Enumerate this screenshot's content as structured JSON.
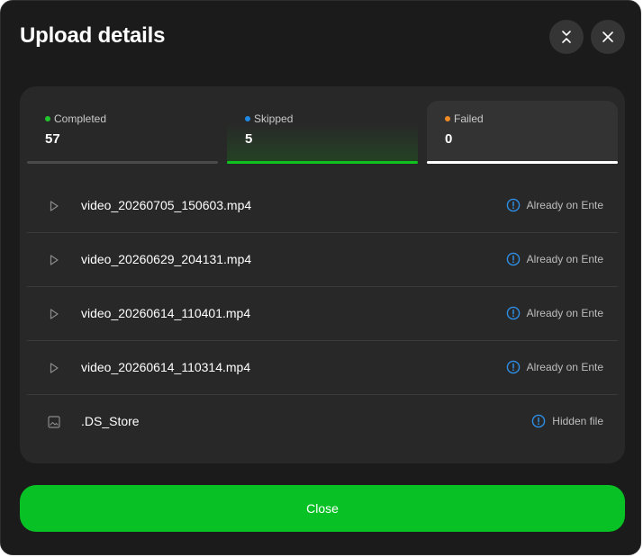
{
  "dialog": {
    "title": "Upload details",
    "collapse_icon": "collapse-chevrons-icon",
    "close_icon": "close-icon"
  },
  "tabs": [
    {
      "label": "Completed",
      "count": "57",
      "dot_color": "#22c52e",
      "bar_color": "#4a4a4a",
      "selected": false
    },
    {
      "label": "Skipped",
      "count": "5",
      "dot_color": "#1e88e5",
      "bar_color": "#10c21f",
      "selected": false
    },
    {
      "label": "Failed",
      "count": "0",
      "dot_color": "#f08a24",
      "bar_color": "#ffffff",
      "selected": true
    }
  ],
  "files": [
    {
      "name": "video_20260705_150603.mp4",
      "icon": "play-icon",
      "status": "Already on Ente",
      "status_icon": "info-icon"
    },
    {
      "name": "video_20260629_204131.mp4",
      "icon": "play-icon",
      "status": "Already on Ente",
      "status_icon": "info-icon"
    },
    {
      "name": "video_20260614_110401.mp4",
      "icon": "play-icon",
      "status": "Already on Ente",
      "status_icon": "info-icon"
    },
    {
      "name": "video_20260614_110314.mp4",
      "icon": "play-icon",
      "status": "Already on Ente",
      "status_icon": "info-icon"
    },
    {
      "name": ".DS_Store",
      "icon": "image-icon",
      "status": "Hidden file",
      "status_icon": "info-icon"
    }
  ],
  "footer": {
    "close_label": "Close"
  },
  "colors": {
    "accent": "#08c225",
    "info": "#2f8fe6",
    "background": "#1b1b1b",
    "panel": "#282828"
  }
}
